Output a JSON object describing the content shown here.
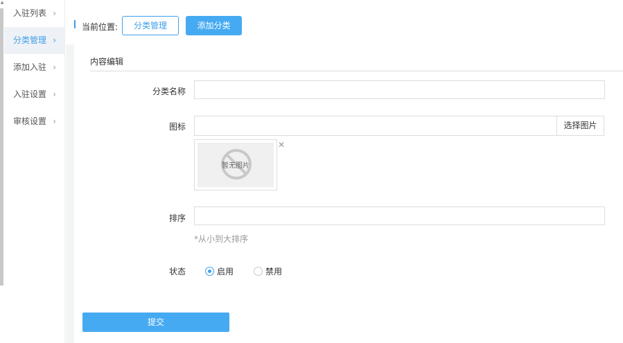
{
  "sidebar": {
    "items": [
      {
        "label": "入驻列表",
        "active": false
      },
      {
        "label": "分类管理",
        "active": true
      },
      {
        "label": "添加入驻",
        "active": false
      },
      {
        "label": "入驻设置",
        "active": false
      },
      {
        "label": "审核设置",
        "active": false
      }
    ],
    "chevron_icon": "chevron-right-icon"
  },
  "header": {
    "breadcrumb_label": "当前位置:",
    "tab_category_manage": "分类管理",
    "tab_add_category": "添加分类"
  },
  "panel": {
    "title": "内容编辑"
  },
  "form": {
    "name_label": "分类名称",
    "name_value": "",
    "icon_label": "图标",
    "icon_value": "",
    "select_image_label": "选择图片",
    "no_image_text": "暂无图片",
    "remove_image_icon": "close-icon",
    "sort_label": "排序",
    "sort_value": "",
    "sort_hint": "*从小到大排序",
    "status_label": "状态",
    "status_options": [
      {
        "label": "启用",
        "checked": true
      },
      {
        "label": "禁用",
        "checked": false
      }
    ],
    "submit_label": "提交"
  },
  "colors": {
    "accent": "#3fa0e8",
    "button_bg": "#45aaf2",
    "sidebar_active_bg": "#eef1f6",
    "page_bg": "#f3f4f6"
  }
}
